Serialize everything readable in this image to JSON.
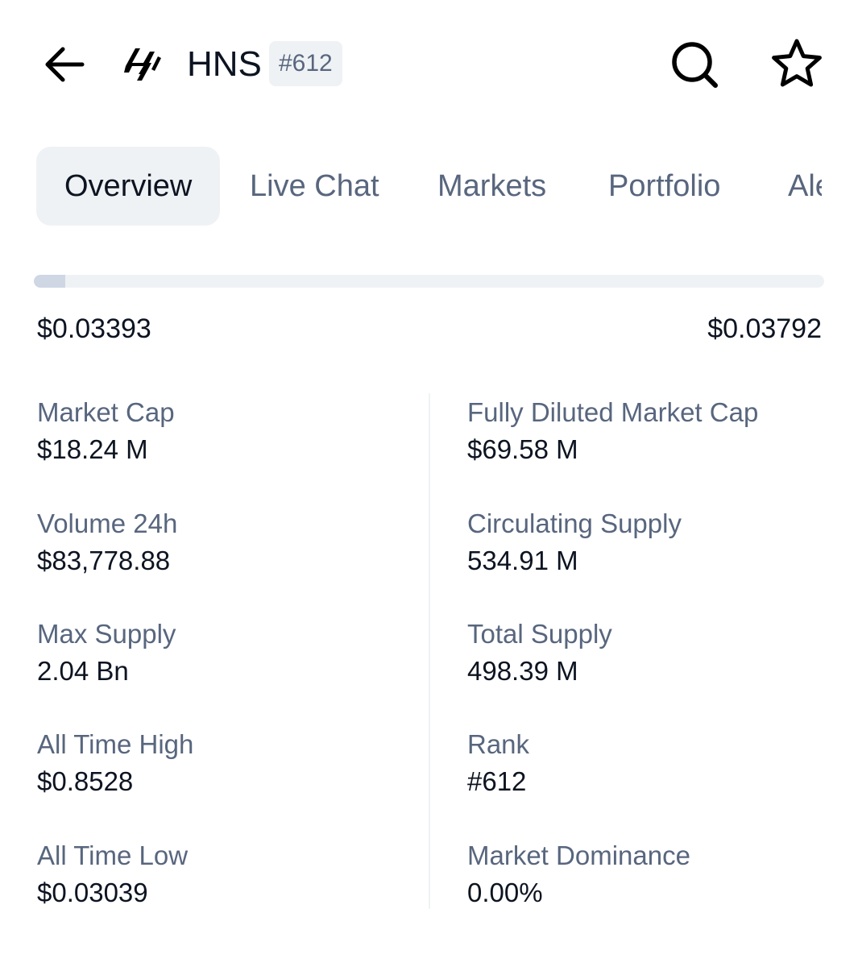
{
  "header": {
    "symbol": "HNS",
    "rank_badge": "#612",
    "icons": {
      "back": "arrow-left-icon",
      "logo": "handshake-logo-icon",
      "search": "search-icon",
      "star": "star-icon"
    }
  },
  "tabs": [
    {
      "label": "Overview",
      "active": true
    },
    {
      "label": "Live Chat",
      "active": false
    },
    {
      "label": "Markets",
      "active": false
    },
    {
      "label": "Portfolio",
      "active": false
    },
    {
      "label": "Alerts",
      "active": false
    }
  ],
  "price_range": {
    "low": "$0.03393",
    "high": "$0.03792",
    "fill_fraction": 0.04
  },
  "stats": {
    "left": [
      {
        "label": "Market Cap",
        "value": "$18.24 M"
      },
      {
        "label": "Volume 24h",
        "value": "$83,778.88"
      },
      {
        "label": "Max Supply",
        "value": "2.04 Bn"
      },
      {
        "label": "All Time High",
        "value": "$0.8528"
      },
      {
        "label": "All Time Low",
        "value": "$0.03039"
      }
    ],
    "right": [
      {
        "label": "Fully Diluted Market Cap",
        "value": "$69.58 M"
      },
      {
        "label": "Circulating Supply",
        "value": "534.91 M"
      },
      {
        "label": "Total Supply",
        "value": "498.39 M"
      },
      {
        "label": "Rank",
        "value": "#612"
      },
      {
        "label": "Market Dominance",
        "value": "0.00%"
      }
    ]
  },
  "colors": {
    "text_primary": "#0d1421",
    "text_secondary": "#58667e",
    "surface": "#eff2f5",
    "range_fill": "#cfd6e4"
  }
}
